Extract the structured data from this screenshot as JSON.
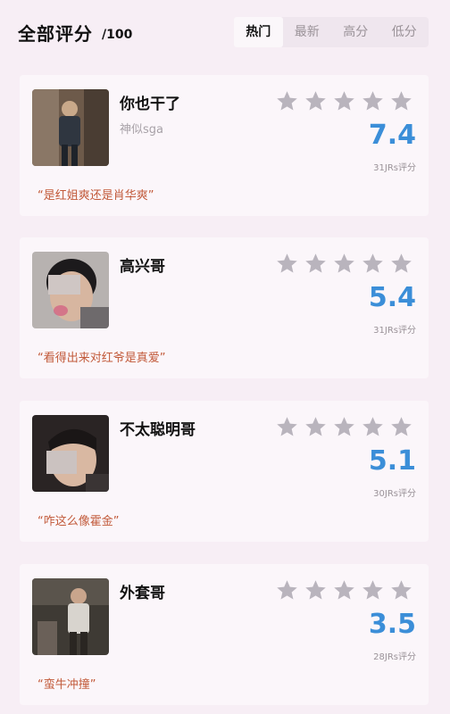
{
  "header": {
    "title": "全部评分",
    "title_suffix": "/100",
    "tabs": [
      {
        "label": "热门",
        "active": true
      },
      {
        "label": "最新",
        "active": false
      },
      {
        "label": "高分",
        "active": false
      },
      {
        "label": "低分",
        "active": false
      }
    ]
  },
  "cards": [
    {
      "name": "你也干了",
      "subname": "神似sga",
      "score": "7.4",
      "reviews": "31JRs评分",
      "quote": "“是红姐爽还是肖华爽”"
    },
    {
      "name": "高兴哥",
      "subname": "",
      "score": "5.4",
      "reviews": "31JRs评分",
      "quote": "“看得出来对红爷是真爱”"
    },
    {
      "name": "不太聪明哥",
      "subname": "",
      "score": "5.1",
      "reviews": "30JRs评分",
      "quote": "“咋这么像霍金”"
    },
    {
      "name": "外套哥",
      "subname": "",
      "score": "3.5",
      "reviews": "28JRs评分",
      "quote": "“蛮牛冲撞”"
    }
  ],
  "colors": {
    "score": "#3b8ed8",
    "quote": "#c25a3a",
    "star": "#b9b4bd"
  },
  "icons": {
    "star": "star-icon",
    "avatar": "avatar-photo"
  }
}
